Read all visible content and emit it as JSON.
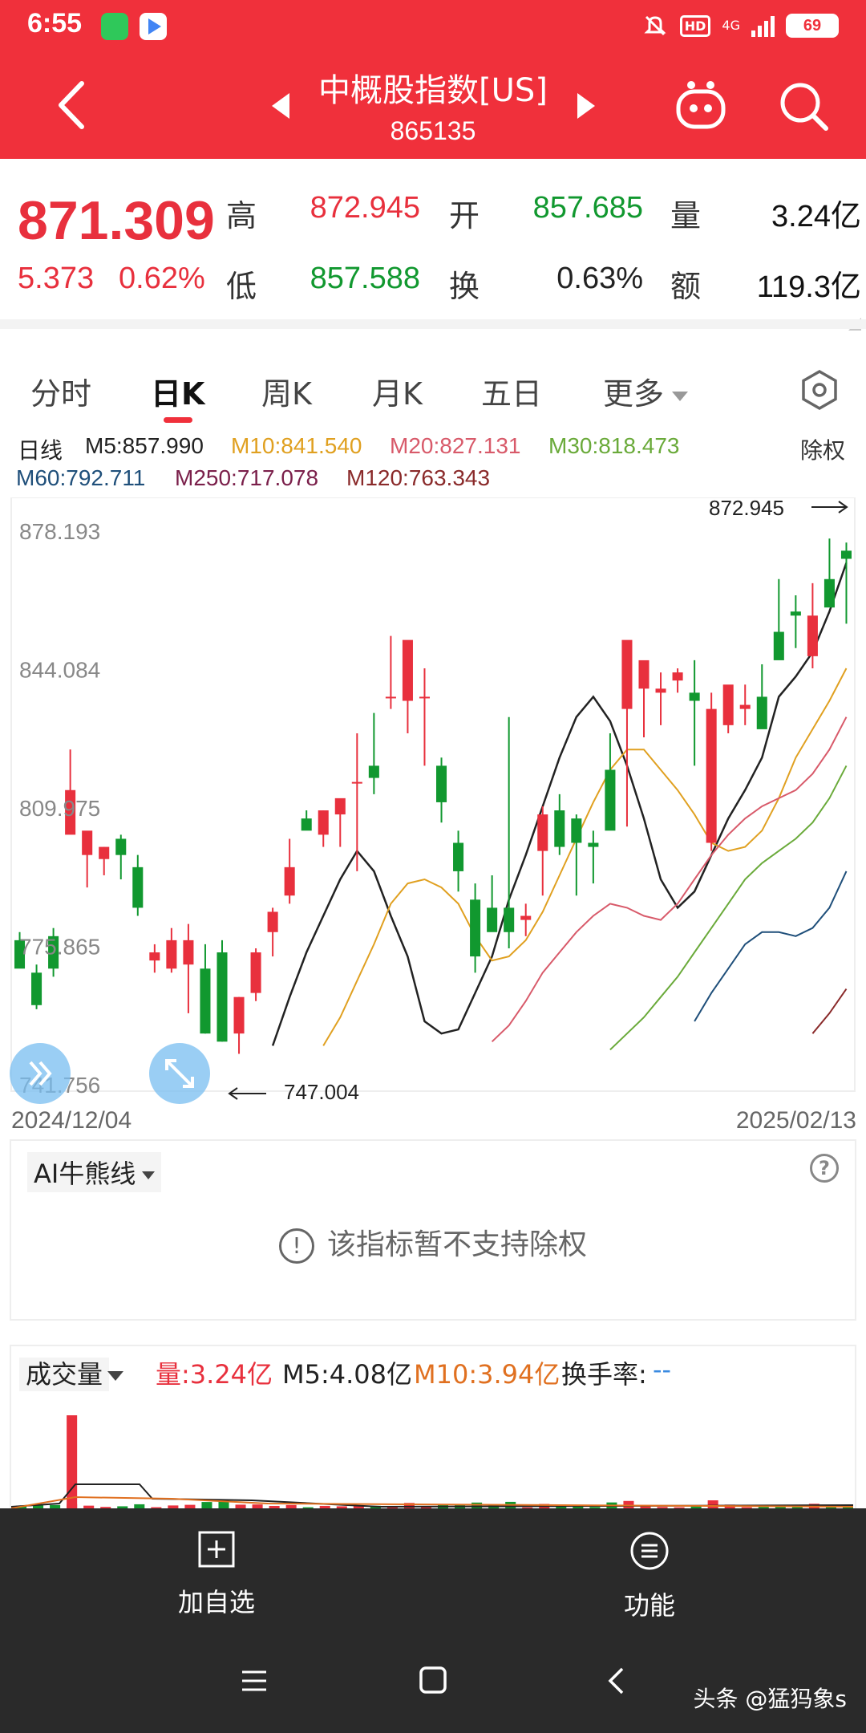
{
  "status_bar": {
    "time": "6:55",
    "network": "4G",
    "hd": "HD",
    "battery": "69"
  },
  "header": {
    "title": "中概股指数[US]",
    "code": "865135"
  },
  "quote": {
    "price": "871.309",
    "change": "5.373",
    "change_pct": "0.62%",
    "high_label": "高",
    "high": "872.945",
    "low_label": "低",
    "low": "857.588",
    "open_label": "开",
    "open": "857.685",
    "turnover_rate_label": "换",
    "turnover_rate": "0.63%",
    "volume_label": "量",
    "volume": "3.24亿",
    "amount_label": "额",
    "amount": "119.3亿",
    "colors": {
      "up": "#e8303d",
      "down": "#11982f"
    }
  },
  "tabs": {
    "items": [
      "分时",
      "日K",
      "周K",
      "月K",
      "五日",
      "更多"
    ],
    "active": "日K"
  },
  "ma_legend": {
    "period": "日线",
    "ma5": "M5:857.990",
    "ma10": "M10:841.540",
    "ma20": "M20:827.131",
    "ma30": "M30:818.473",
    "ma60": "M60:792.711",
    "ma250": "M250:717.078",
    "ma120": "M120:763.343",
    "adjust": "除权",
    "colors": {
      "ma5": "#222222",
      "ma10": "#e0a020",
      "ma20": "#d85a6a",
      "ma30": "#6aaa3a",
      "ma60": "#1f4f7a",
      "ma250": "#7a1f4a",
      "ma120": "#8a2a2a"
    }
  },
  "chart_data": {
    "type": "candlestick",
    "y_ticks": [
      "878.193",
      "844.084",
      "809.975",
      "775.865",
      "741.756"
    ],
    "ylim": [
      741.756,
      878.193
    ],
    "start_date": "2024/12/04",
    "end_date": "2025/02/13",
    "max_label": "872.945",
    "min_label": "747.004",
    "candles": [
      {
        "o": 775,
        "h": 777,
        "l": 769,
        "c": 768
      },
      {
        "o": 767,
        "h": 769,
        "l": 758,
        "c": 759
      },
      {
        "o": 776,
        "h": 778,
        "l": 766,
        "c": 768
      },
      {
        "o": 801,
        "h": 822,
        "l": 809,
        "c": 812
      },
      {
        "o": 796,
        "h": 800,
        "l": 788,
        "c": 802
      },
      {
        "o": 795,
        "h": 798,
        "l": 791,
        "c": 798
      },
      {
        "o": 800,
        "h": 801,
        "l": 790,
        "c": 796
      },
      {
        "o": 793,
        "h": 796,
        "l": 781,
        "c": 783
      },
      {
        "o": 770,
        "h": 774,
        "l": 767,
        "c": 772
      },
      {
        "o": 768,
        "h": 778,
        "l": 767,
        "c": 775
      },
      {
        "o": 769,
        "h": 779,
        "l": 757,
        "c": 775
      },
      {
        "o": 768,
        "h": 774,
        "l": 752,
        "c": 752
      },
      {
        "o": 772,
        "h": 775,
        "l": 750,
        "c": 750
      },
      {
        "o": 752,
        "h": 761,
        "l": 747,
        "c": 761
      },
      {
        "o": 762,
        "h": 773,
        "l": 760,
        "c": 772
      },
      {
        "o": 777,
        "h": 783,
        "l": 771,
        "c": 782
      },
      {
        "o": 786,
        "h": 800,
        "l": 784,
        "c": 793
      },
      {
        "o": 805,
        "h": 807,
        "l": 804,
        "c": 802
      },
      {
        "o": 801,
        "h": 807,
        "l": 798,
        "c": 807
      },
      {
        "o": 806,
        "h": 809,
        "l": 798,
        "c": 810
      },
      {
        "o": 814,
        "h": 826,
        "l": 792,
        "c": 814
      },
      {
        "o": 818,
        "h": 831,
        "l": 811,
        "c": 815
      },
      {
        "o": 835,
        "h": 850,
        "l": 832,
        "c": 835
      },
      {
        "o": 834,
        "h": 840,
        "l": 826,
        "c": 849
      },
      {
        "o": 835,
        "h": 842,
        "l": 818,
        "c": 835
      },
      {
        "o": 818,
        "h": 820,
        "l": 804,
        "c": 809
      },
      {
        "o": 799,
        "h": 802,
        "l": 787,
        "c": 792
      },
      {
        "o": 785,
        "h": 789,
        "l": 767,
        "c": 771
      },
      {
        "o": 783,
        "h": 791,
        "l": 778,
        "c": 777
      },
      {
        "o": 783,
        "h": 830,
        "l": 773,
        "c": 777
      },
      {
        "o": 780,
        "h": 784,
        "l": 776,
        "c": 781
      },
      {
        "o": 797,
        "h": 808,
        "l": 786,
        "c": 806
      },
      {
        "o": 807,
        "h": 811,
        "l": 796,
        "c": 798
      },
      {
        "o": 805,
        "h": 806,
        "l": 786,
        "c": 799
      },
      {
        "o": 799,
        "h": 802,
        "l": 789,
        "c": 798
      },
      {
        "o": 817,
        "h": 826,
        "l": 806,
        "c": 802
      },
      {
        "o": 832,
        "h": 834,
        "l": 803,
        "c": 849
      },
      {
        "o": 837,
        "h": 841,
        "l": 825,
        "c": 844
      },
      {
        "o": 836,
        "h": 841,
        "l": 828,
        "c": 837
      },
      {
        "o": 839,
        "h": 842,
        "l": 836,
        "c": 841
      },
      {
        "o": 836,
        "h": 844,
        "l": 818,
        "c": 834
      },
      {
        "o": 799,
        "h": 836,
        "l": 797,
        "c": 832
      },
      {
        "o": 828,
        "h": 837,
        "l": 826,
        "c": 838
      },
      {
        "o": 832,
        "h": 838,
        "l": 828,
        "c": 833
      },
      {
        "o": 835,
        "h": 843,
        "l": 831,
        "c": 827
      },
      {
        "o": 851,
        "h": 864,
        "l": 848,
        "c": 844
      },
      {
        "o": 856,
        "h": 860,
        "l": 847,
        "c": 855
      },
      {
        "o": 845,
        "h": 863,
        "l": 842,
        "c": 855
      },
      {
        "o": 864,
        "h": 874,
        "l": 861,
        "c": 857
      },
      {
        "o": 871,
        "h": 873,
        "l": 853,
        "c": 869
      }
    ],
    "ma_lines": {
      "ma5": [
        749,
        761,
        772,
        781,
        790,
        797,
        792,
        781,
        771,
        755,
        752,
        753,
        762,
        771,
        785,
        796,
        808,
        820,
        830,
        835,
        829,
        818,
        805,
        790,
        783,
        787,
        796,
        805,
        812,
        820,
        835,
        840,
        846,
        856,
        868
      ],
      "ma10": [
        749,
        756,
        765,
        774,
        784,
        789,
        790,
        788,
        784,
        776,
        770,
        771,
        775,
        782,
        791,
        800,
        809,
        817,
        822,
        822,
        817,
        812,
        806,
        799,
        797,
        798,
        802,
        810,
        820,
        827,
        834,
        842
      ],
      "ma20": [
        750,
        754,
        760,
        767,
        772,
        777,
        781,
        784,
        783,
        781,
        780,
        784,
        790,
        796,
        801,
        805,
        808,
        810,
        812,
        816,
        822,
        830
      ],
      "ma30": [
        748,
        752,
        756,
        761,
        766,
        772,
        778,
        784,
        790,
        794,
        797,
        800,
        804,
        810,
        818
      ],
      "ma60": [
        755,
        762,
        768,
        774,
        777,
        777,
        776,
        778,
        783,
        792
      ],
      "ma120": [
        752,
        757,
        763
      ]
    }
  },
  "indicator_panel": {
    "name": "AI牛熊线",
    "message": "该指标暂不支持除权"
  },
  "volume_panel": {
    "name": "成交量",
    "vol": "量:3.24亿",
    "m5": "M5:4.08亿",
    "m10": "M10:3.94亿",
    "turnover_label": "换手率:",
    "turnover_value": "--"
  },
  "bottom_actions": {
    "add_watchlist": "加自选",
    "functions": "功能"
  },
  "watermark": "头条 @猛犸象s"
}
